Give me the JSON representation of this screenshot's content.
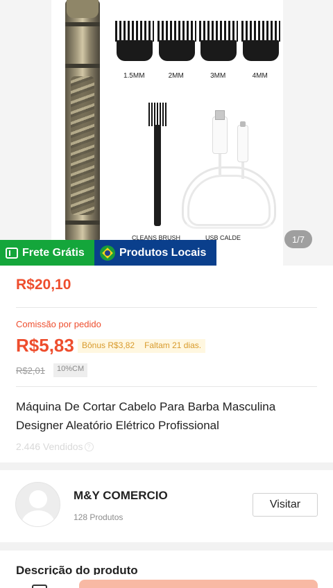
{
  "gallery": {
    "comb_labels": [
      "1.5MM",
      "2MM",
      "3MM",
      "4MM"
    ],
    "caption_brush": "CLEANS BRUSH",
    "caption_usb": "USB CALDE",
    "counter": "1/7"
  },
  "badges": {
    "shipping": "Frete Grátis",
    "local": "Produtos Locais"
  },
  "price": {
    "current": "R$20,10",
    "commission_label": "Comissão por pedido",
    "commission_value": "R$5,83",
    "bonus": "Bônus R$3,82",
    "days_left": "Faltam 21 dias.",
    "old_commission": "R$2,01",
    "cm_rate": "10%CM"
  },
  "product": {
    "title": "Máquina De Cortar Cabelo Para Barba Masculina Designer Aleatório Elétrico Profissional",
    "sold": "2.446 Vendidos"
  },
  "shop": {
    "name": "M&Y COMERCIO",
    "product_count": "128 Produtos",
    "visit_label": "Visitar"
  },
  "description": {
    "title": "Descrição do produto"
  },
  "colors": {
    "accent": "#ee4d2d",
    "shipping_badge": "#14a63b",
    "local_badge": "#0a3f8c"
  }
}
